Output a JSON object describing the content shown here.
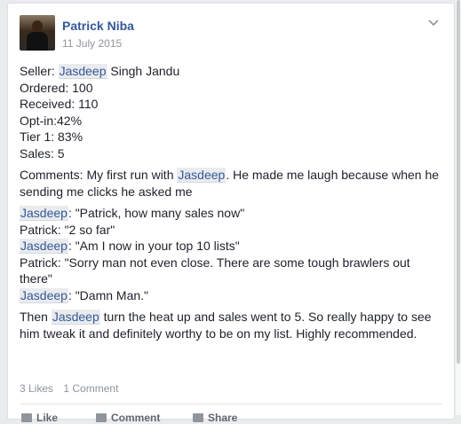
{
  "post": {
    "author": "Patrick Niba",
    "date": "11 July 2015",
    "lines": {
      "seller_prefix": "Seller: ",
      "seller_name": "Jasdeep",
      "seller_rest": " Singh Jandu",
      "ordered": "Ordered: 100",
      "received": "Received: 110",
      "optin": "Opt-in:42%",
      "tier1": "Tier 1: 83%",
      "sales": "Sales: 5"
    },
    "comments": {
      "prefix": "Comments: My first run with ",
      "tag": "Jasdeep",
      "suffix": ". He made me laugh because when he sending me clicks he asked me"
    },
    "dialogue": [
      {
        "tag": "Jasdeep",
        "text": ": \"Patrick, how many sales now\""
      },
      {
        "tag": "",
        "text": "Patrick: \"2 so far\""
      },
      {
        "tag": "Jasdeep",
        "text": ": \"Am I now in your top 10 lists\""
      },
      {
        "tag": "",
        "text": "Patrick: \"Sorry man not even close. There are some tough brawlers out there\""
      },
      {
        "tag": "Jasdeep",
        "text": ": \"Damn Man.\""
      }
    ],
    "closing": {
      "prefix": "Then ",
      "tag": "Jasdeep",
      "suffix": " turn the heat up and sales went to 5. So really happy to see him tweak it and definitely worthy to be on my list. Highly recommended."
    },
    "likes": "3 Likes",
    "comment_count": "1 Comment",
    "actions": {
      "like": "Like",
      "comment": "Comment",
      "share": "Share"
    }
  }
}
